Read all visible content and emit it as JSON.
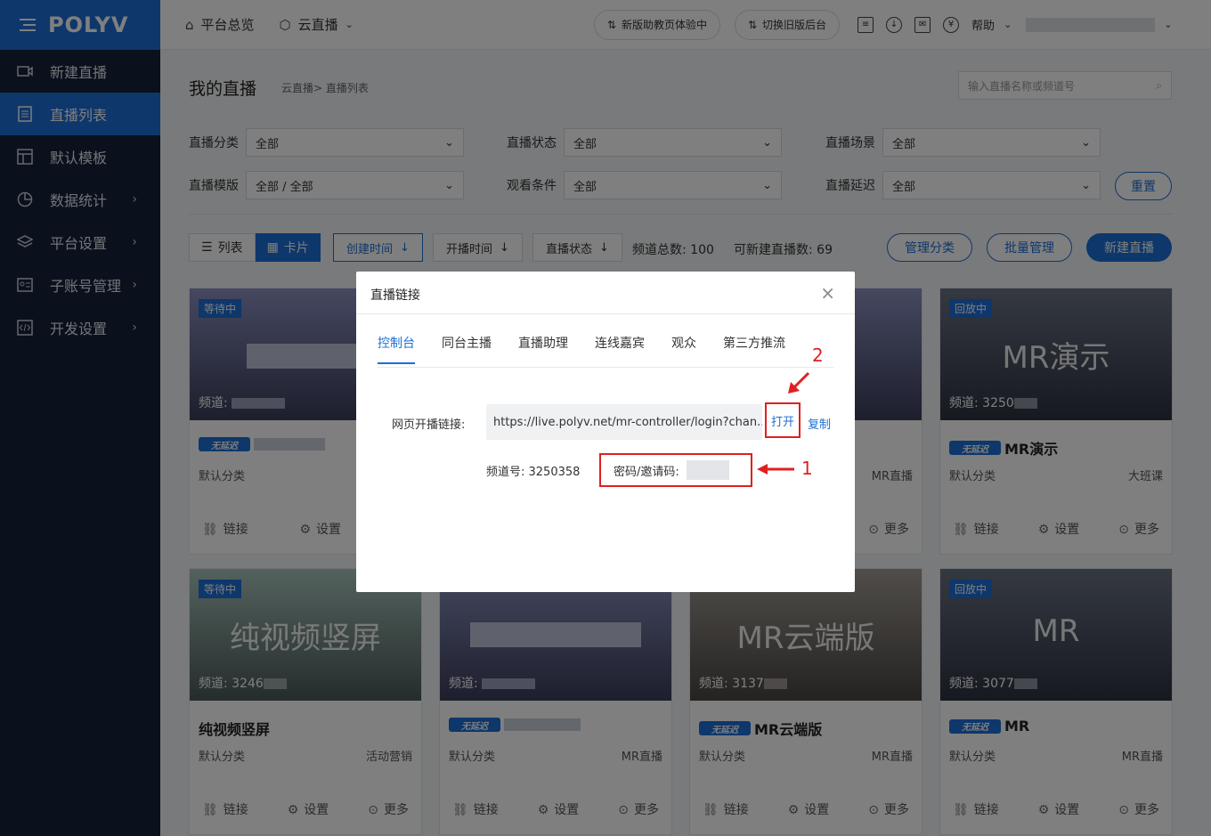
{
  "app": {
    "brand": "POLYV"
  },
  "sidebar": {
    "items": [
      {
        "label": "新建直播",
        "icon": "video-icon",
        "arrow": false
      },
      {
        "label": "直播列表",
        "icon": "list-icon",
        "arrow": false,
        "active": true
      },
      {
        "label": "默认模板",
        "icon": "template-icon",
        "arrow": false
      },
      {
        "label": "数据统计",
        "icon": "chart-icon",
        "arrow": true
      },
      {
        "label": "平台设置",
        "icon": "layers-icon",
        "arrow": true
      },
      {
        "label": "子账号管理",
        "icon": "id-card-icon",
        "arrow": true
      },
      {
        "label": "开发设置",
        "icon": "code-icon",
        "arrow": true
      }
    ]
  },
  "topbar": {
    "overview": "平台总览",
    "cloud_live": "云直播",
    "new_helper": "新版助教页体验中",
    "old_backend": "切换旧版后台",
    "help": "帮助"
  },
  "page": {
    "title": "我的直播",
    "breadcrumb": "云直播> 直播列表",
    "search_placeholder": "输入直播名称或频道号"
  },
  "filters": [
    {
      "label": "直播分类",
      "value": "全部"
    },
    {
      "label": "直播状态",
      "value": "全部"
    },
    {
      "label": "直播场景",
      "value": "全部"
    },
    {
      "label": "直播模版",
      "value": "全部 / 全部"
    },
    {
      "label": "观看条件",
      "value": "全部"
    },
    {
      "label": "直播延迟",
      "value": "全部"
    }
  ],
  "reset": "重置",
  "toolbar": {
    "list": "列表",
    "card": "卡片",
    "sort_created": "创建时间",
    "sort_start": "开播时间",
    "sort_status": "直播状态",
    "total_label": "频道总数: 100",
    "creatable_label": "可新建直播数: 69",
    "manage_category": "管理分类",
    "batch_manage": "批量管理",
    "new_live": "新建直播"
  },
  "cards": [
    {
      "status": "等待中",
      "big": "",
      "chan": "频道:",
      "title": "",
      "category": "默认分类",
      "scene": ""
    },
    {
      "status": "回放中",
      "big": "MR演示",
      "chan": "频道: 3250",
      "title": "MR演示",
      "category": "默认分类",
      "scene": "大班课"
    },
    {
      "status": "等待中",
      "big": "纯视频竖屏",
      "chan": "频道: 3246",
      "title": "纯视频竖屏",
      "category": "默认分类",
      "scene": "活动营销"
    },
    {
      "status": "",
      "big": "",
      "chan": "频道:",
      "title": "",
      "category": "默认分类",
      "scene": "MR直播"
    },
    {
      "status": "",
      "big": "MR云端版",
      "chan": "频道: 3137",
      "title": "MR云端版",
      "category": "默认分类",
      "scene": "MR直播"
    },
    {
      "status": "回放中",
      "big": "MR",
      "chan": "频道: 3077",
      "title": "MR",
      "category": "默认分类",
      "scene": "MR直播"
    }
  ],
  "partial_scene": "MR直播",
  "card_actions": {
    "link": "链接",
    "settings": "设置",
    "more": "更多"
  },
  "low_delay_badge": "无延迟",
  "modal": {
    "title": "直播链接",
    "tabs": [
      "控制台",
      "同台主播",
      "直播助理",
      "连线嘉宾",
      "观众",
      "第三方推流"
    ],
    "link_label": "网页开播链接:",
    "link_value": "https://live.polyv.net/mr-controller/login?chan...",
    "open": "打开",
    "copy": "复制",
    "channel_info": "频道号: 3250358",
    "password_label": "密码/邀请码:"
  },
  "annotations": {
    "one": "1",
    "two": "2"
  },
  "colors": {
    "primary": "#1d6fd6",
    "sidebar": "#152039",
    "annotation": "#e02020"
  }
}
